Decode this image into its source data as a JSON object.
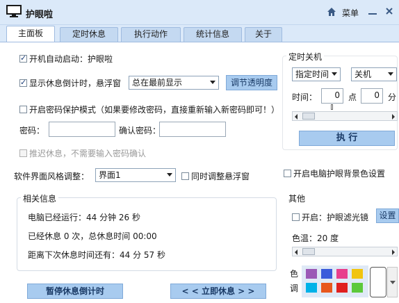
{
  "window": {
    "title": "护眼啦",
    "menu_label": "菜单"
  },
  "tabs": [
    {
      "label": "主面板",
      "active": true
    },
    {
      "label": "定时休息",
      "active": false
    },
    {
      "label": "执行动作",
      "active": false
    },
    {
      "label": "统计信息",
      "active": false
    },
    {
      "label": "关于",
      "active": false
    }
  ],
  "main": {
    "autostart": {
      "label": "开机自动启动：护眼啦",
      "checked": true
    },
    "show_countdown": {
      "label": "显示休息倒计时，悬浮窗",
      "checked": true
    },
    "float_mode_select": "总在最前显示",
    "transparency_button": "调节透明度",
    "password_mode": {
      "label": "开启密码保护模式（如果要修改密码，直接重新输入新密码即可！）",
      "checked": false
    },
    "password_label": "密码：",
    "password_value": "",
    "confirm_password_label": "确认密码：",
    "confirm_password_value": "",
    "postpone": {
      "label": "推迟休息，不需要输入密码确认",
      "checked": false,
      "disabled": true
    },
    "style_label": "软件界面风格调整：",
    "style_select": "界面1",
    "sync_float": {
      "label": "同时调整悬浮窗",
      "checked": false
    }
  },
  "info": {
    "title": "相关信息",
    "line1": "电脑已经运行：44 分钟 26 秒",
    "line2": "已经休息 0 次，总休息时间 00:00",
    "line3": "距离下次休息时间还有：44 分 57 秒"
  },
  "buttons": {
    "pause": "暂停休息倒计时",
    "rest_now": "< < 立即休息 > >"
  },
  "shutdown": {
    "title": "定时关机",
    "mode_select": "指定时间",
    "action_select": "关机",
    "time_label": "时间：",
    "hour_value": "0",
    "hour_unit": "点",
    "minute_value": "0",
    "minute_unit": "分",
    "execute_button": "执 行"
  },
  "bg_color": {
    "label": "开启电脑护眼背景色设置",
    "checked": false
  },
  "other": {
    "title": "其他",
    "filter": {
      "label": "开启：护眼滤光镜",
      "checked": false
    },
    "settings_button": "设置",
    "temperature_label": "色温：20 度",
    "palette_label_top": "色",
    "palette_label_bottom": "调"
  },
  "palette_colors": [
    "#9b59b6",
    "#3b5bdb",
    "#e83e8c",
    "#f1c40f",
    "#00b2e8",
    "#e8571e",
    "#e02020",
    "#5cc93b"
  ],
  "theme": {
    "title_bar": "#dbe9f9",
    "accent_button": "#a8cbef",
    "tab_active": "#ffffff",
    "tab_inactive": "#c4d9f1"
  }
}
